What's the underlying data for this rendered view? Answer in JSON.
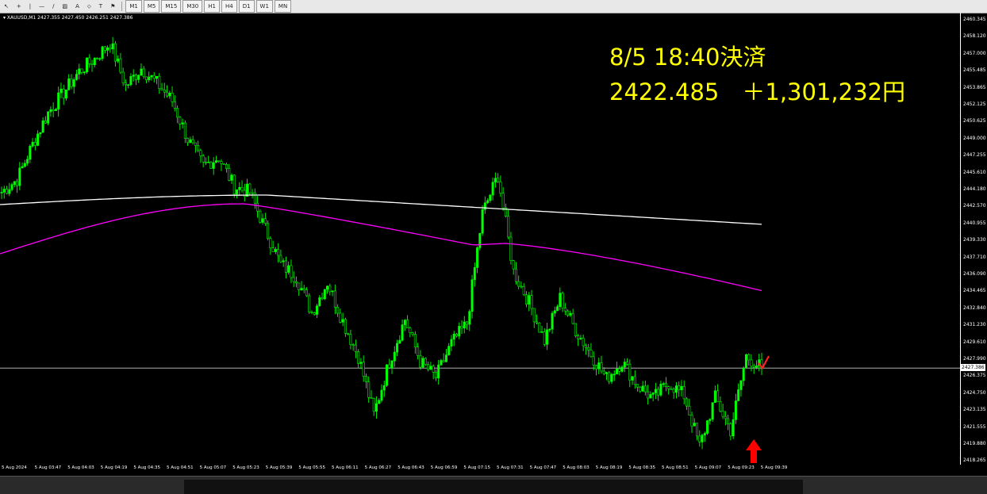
{
  "toolbar": {
    "tools": [
      "↖",
      "+",
      "|",
      "—",
      "/",
      "▨",
      "A",
      "⬦",
      "T",
      "⚑"
    ],
    "timeframes": [
      "M1",
      "M5",
      "M15",
      "M30",
      "H1",
      "H4",
      "D1",
      "W1",
      "MN"
    ]
  },
  "chart": {
    "symbol_line": "▾ XAUUSD,M1  2427.355 2427.450 2426.251 2427.386",
    "annotation_line1": "8/5 18:40決済",
    "annotation_line2": "2422.485　＋1,301,232円",
    "current_price_label": "2427.386",
    "colors": {
      "bull": "#00ff00",
      "ma_white": "#ffffff",
      "ma_magenta": "#ff00ff",
      "annotation": "#ffff00",
      "arrow": "#ff0000",
      "check": "#ff2020"
    }
  },
  "price_axis": {
    "ticks": [
      "2460.345",
      "2458.120",
      "2457.000",
      "2455.485",
      "2453.865",
      "2452.125",
      "2450.625",
      "2449.000",
      "2447.255",
      "2445.610",
      "2444.180",
      "2442.570",
      "2440.955",
      "2439.330",
      "2437.710",
      "2436.090",
      "2434.465",
      "2432.840",
      "2431.230",
      "2429.610",
      "2427.990",
      "2426.375",
      "2424.750",
      "2423.135",
      "2421.555",
      "2419.880",
      "2418.265"
    ]
  },
  "time_axis": {
    "labels": [
      "5 Aug 2024",
      "5 Aug 03:47",
      "5 Aug 04:03",
      "5 Aug 04:19",
      "5 Aug 04:35",
      "5 Aug 04:51",
      "5 Aug 05:07",
      "5 Aug 05:23",
      "5 Aug 05:39",
      "5 Aug 05:55",
      "5 Aug 06:11",
      "5 Aug 06:27",
      "5 Aug 06:43",
      "5 Aug 06:59",
      "5 Aug 07:15",
      "5 Aug 07:31",
      "5 Aug 07:47",
      "5 Aug 08:03",
      "5 Aug 08:19",
      "5 Aug 08:35",
      "5 Aug 08:51",
      "5 Aug 09:07",
      "5 Aug 09:23",
      "5 Aug 09:39"
    ]
  },
  "chart_data": {
    "type": "line",
    "symbol": "XAUUSD,M1",
    "ylim": [
      2418.265,
      2460.345
    ],
    "series": [
      {
        "values": [
          2444.0,
          2445.2,
          2448.5,
          2451.5,
          2453.4,
          2455.4,
          2456.6,
          2458.1,
          2454.0,
          2455.7,
          2454.3,
          2452.6,
          2449.0,
          2446.5,
          2447.3,
          2444.5,
          2444.0,
          2440.5,
          2437.2,
          2436.0,
          2432.6,
          2435.5,
          2431.8,
          2428.5,
          2423.0,
          2428.0,
          2432.0,
          2428.0,
          2426.5,
          2429.7,
          2431.6,
          2442.0,
          2445.6,
          2436.5,
          2433.6,
          2430.0,
          2434.0,
          2431.0,
          2428.7,
          2426.4,
          2428.0,
          2425.8,
          2424.5,
          2426.0,
          2424.8,
          2420.0,
          2424.6,
          2421.5,
          2428.5,
          2427.4
        ]
      }
    ],
    "current_price": 2427.386
  }
}
